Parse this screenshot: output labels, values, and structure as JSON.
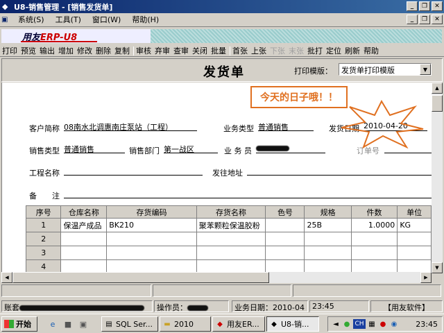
{
  "window": {
    "title": "U8-销售管理 - [销售发货单]",
    "min": "_",
    "max": "❐",
    "close": "✕"
  },
  "menu": [
    {
      "label": "系统(S)"
    },
    {
      "label": "工具(T)"
    },
    {
      "label": "窗口(W)"
    },
    {
      "label": "帮助(H)"
    }
  ],
  "logo": {
    "brand": "用友",
    "product": "ERP-",
    "suffix": "U8"
  },
  "toolbar": {
    "group1": [
      "打印",
      "预览",
      "输出",
      "增加",
      "修改",
      "删除",
      "复制"
    ],
    "group2": [
      "审核",
      "弃审",
      "查审",
      "关闭",
      "批量"
    ],
    "group3": [
      {
        "label": "首张",
        "disabled": false
      },
      {
        "label": "上张",
        "disabled": false
      },
      {
        "label": "下张",
        "disabled": true
      },
      {
        "label": "末张",
        "disabled": true
      }
    ],
    "group4": [
      "批打",
      "定位",
      "刷新",
      "帮助"
    ]
  },
  "doc": {
    "title": "发货单",
    "print_template_label": "打印模版：",
    "print_template_value": "发货单打印模版"
  },
  "callout": "今天的日子哦！！",
  "form": {
    "customer_label": "客户简称",
    "customer_value": "08南水北调惠南庄泵站（工程）",
    "biz_type_label": "业务类型",
    "biz_type_value": "普通销售",
    "ship_date_label": "发货日期",
    "ship_date_value": "2010-04-20",
    "sales_type_label": "销售类型",
    "sales_type_value": "普通销售",
    "dept_label": "销售部门",
    "dept_value": "第一战区",
    "staff_label": "业 务 员",
    "order_label": "订单号",
    "project_label": "工程名称",
    "ship_addr_label": "发往地址",
    "remark_label": "备　　注"
  },
  "grid": {
    "columns": [
      "序号",
      "仓库名称",
      "存货编码",
      "存货名称",
      "色号",
      "规格",
      "件数",
      "单位"
    ],
    "rows": [
      [
        "1",
        "保温产成品",
        "BK210",
        "聚苯颗粒保温胶粉",
        "",
        "25B",
        "1.0000",
        "KG"
      ],
      [
        "2",
        "",
        "",
        "",
        "",
        "",
        "",
        ""
      ],
      [
        "3",
        "",
        "",
        "",
        "",
        "",
        "",
        ""
      ],
      [
        "4",
        "",
        "",
        "",
        "",
        "",
        "",
        ""
      ]
    ]
  },
  "status": {
    "account_label": "账套",
    "operator_label": "操作员：",
    "biz_date": "业务日期：2010-04",
    "time": "23:45",
    "vendor": "【用友软件】"
  },
  "taskbar": {
    "start": "开始",
    "tasks": [
      "SQL Ser...",
      "2010",
      "用友ER...",
      "U8-销..."
    ],
    "tray_lang": "CH",
    "clock": "23:45"
  },
  "colors": {
    "titlebar": "#0a246a",
    "callout": "#e07020",
    "face": "#d4d0c8"
  }
}
